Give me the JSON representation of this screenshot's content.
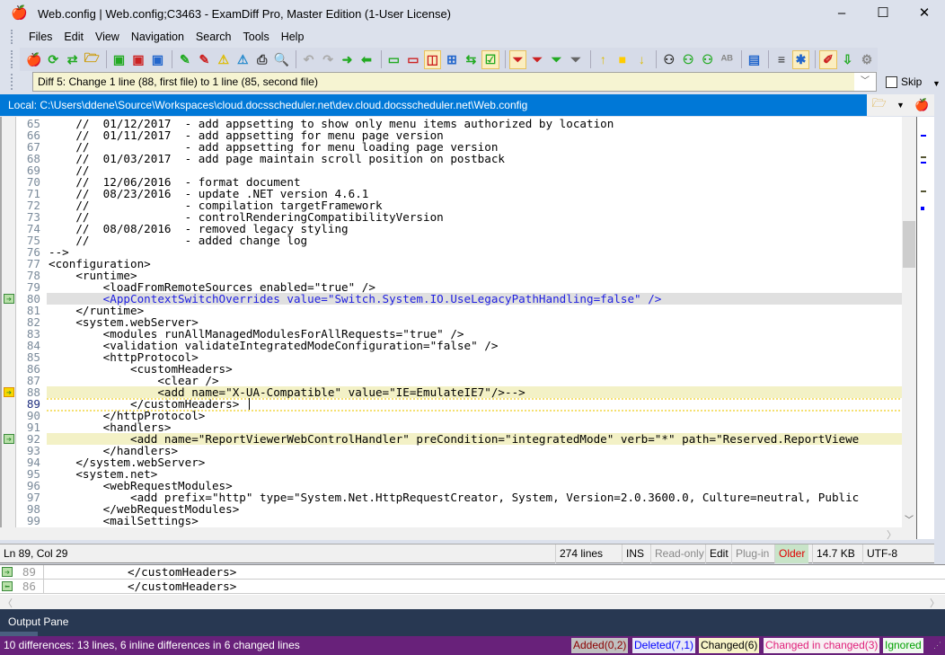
{
  "window": {
    "title": "Web.config  |  Web.config;C3463 - ExamDiff Pro, Master Edition (1-User License)",
    "minimize": "–",
    "maximize": "☐",
    "close": "✕"
  },
  "menu": [
    {
      "label": "Files"
    },
    {
      "label": "Edit"
    },
    {
      "label": "View"
    },
    {
      "label": "Navigation"
    },
    {
      "label": "Search"
    },
    {
      "label": "Tools"
    },
    {
      "label": "Help"
    }
  ],
  "toolbar": {
    "icons": [
      "open-compare",
      "refresh",
      "swap",
      "open-folder",
      "save-first",
      "save-second",
      "save-all",
      "edit-first",
      "edit-second",
      "warn-save",
      "warn-save-web",
      "print",
      "print-preview",
      "undo",
      "redo",
      "copy-right",
      "copy-left",
      "show-first",
      "show-second",
      "show-both",
      "show-grid",
      "compare-sync",
      "check-view",
      "filter-changed",
      "filter-deleted",
      "filter-added",
      "filter-search",
      "prev-diff",
      "current-diff",
      "next-diff",
      "find",
      "find-next",
      "find-prev",
      "ab-compare",
      "layout",
      "word-wrap",
      "plugin",
      "highlight",
      "export",
      "settings"
    ]
  },
  "diff_bar": {
    "text": "Diff 5: Change 1 line (88, first file) to 1 line (85, second file)"
  },
  "skip": {
    "label": "Skip",
    "checked": false
  },
  "path": {
    "text": "Local: C:\\Users\\ddene\\Source\\Workspaces\\cloud.docsscheduler.net\\dev.cloud.docsscheduler.net\\Web.config"
  },
  "editor": {
    "lines": [
      {
        "n": "65",
        "t": "    //  01/12/2017  - add appsetting to show only menu items authorized by location"
      },
      {
        "n": "66",
        "t": "    //  01/11/2017  - add appsetting for menu page version"
      },
      {
        "n": "67",
        "t": "    //              - add appsetting for menu loading page version"
      },
      {
        "n": "68",
        "t": "    //  01/03/2017  - add page maintain scroll position on postback"
      },
      {
        "n": "69",
        "t": "    //"
      },
      {
        "n": "70",
        "t": "    //  12/06/2016  - format document"
      },
      {
        "n": "71",
        "t": "    //  08/23/2016  - update .NET version 4.6.1"
      },
      {
        "n": "72",
        "t": "    //              - compilation targetFramework"
      },
      {
        "n": "73",
        "t": "    //              - controlRenderingCompatibilityVersion"
      },
      {
        "n": "74",
        "t": "    //  08/08/2016  - removed legacy styling"
      },
      {
        "n": "75",
        "t": "    //              - added change log"
      },
      {
        "n": "76",
        "t": "-->"
      },
      {
        "n": "77",
        "t": "<configuration>"
      },
      {
        "n": "78",
        "t": "    <runtime>"
      },
      {
        "n": "79",
        "t": "        <loadFromRemoteSources enabled=\"true\" />"
      },
      {
        "n": "80",
        "t": "        <AppContextSwitchOverrides value=\"Switch.System.IO.UseLegacyPathHandling=false\" />",
        "state": "gray",
        "marker": "right"
      },
      {
        "n": "81",
        "t": "    </runtime>"
      },
      {
        "n": "82",
        "t": "    <system.webServer>"
      },
      {
        "n": "83",
        "t": "        <modules runAllManagedModulesForAllRequests=\"true\" />"
      },
      {
        "n": "84",
        "t": "        <validation validateIntegratedModeConfiguration=\"false\" />"
      },
      {
        "n": "85",
        "t": "        <httpProtocol>"
      },
      {
        "n": "86",
        "t": "            <customHeaders>"
      },
      {
        "n": "87",
        "t": "                <clear />"
      },
      {
        "n": "88",
        "t": "                <add name=\"X-UA-Compatible\" value=\"IE=EmulateIE7\"/>-->",
        "state": "changed",
        "marker": "selected"
      },
      {
        "n": "89",
        "t": "            </customHeaders>",
        "state": "cur"
      },
      {
        "n": "90",
        "t": "        </httpProtocol>"
      },
      {
        "n": "91",
        "t": "        <handlers>"
      },
      {
        "n": "92",
        "t": "            <add name=\"ReportViewerWebControlHandler\" preCondition=\"integratedMode\" verb=\"*\" path=\"Reserved.ReportViewe",
        "state": "changed",
        "marker": "right"
      },
      {
        "n": "93",
        "t": "        </handlers>"
      },
      {
        "n": "94",
        "t": "    </system.webServer>"
      },
      {
        "n": "95",
        "t": "    <system.net>"
      },
      {
        "n": "96",
        "t": "        <webRequestModules>"
      },
      {
        "n": "97",
        "t": "            <add prefix=\"http\" type=\"System.Net.HttpRequestCreator, System, Version=2.0.3600.0, Culture=neutral, Public"
      },
      {
        "n": "98",
        "t": "        </webRequestModules>"
      },
      {
        "n": "99",
        "t": "        <mailSettings>"
      }
    ]
  },
  "status": {
    "position": "Ln 89, Col 29",
    "lines": "274 lines",
    "ins": "INS",
    "readonly": "Read-only",
    "edit": "Edit",
    "plugin": "Plug-in",
    "age": "Older",
    "size": "14.7 KB",
    "encoding": "UTF-8"
  },
  "compare": {
    "first": {
      "n": "89",
      "t": "            </customHeaders>"
    },
    "second": {
      "n": "86",
      "t": "            </customHeaders>"
    }
  },
  "output": {
    "tab": "Output Pane"
  },
  "bottom": {
    "summary": "10 differences: 13 lines, 6 inline differences in 6 changed lines",
    "added": "Added(0,2)",
    "deleted": "Deleted(7,1)",
    "changed": "Changed(6)",
    "changed_in_changed": "Changed in changed(3)",
    "ignored": "Ignored"
  },
  "colors": {
    "accent": "#0078d7",
    "changed": "#f3f1c6",
    "bottom_bar": "#68217a",
    "output_pane": "#283852"
  }
}
